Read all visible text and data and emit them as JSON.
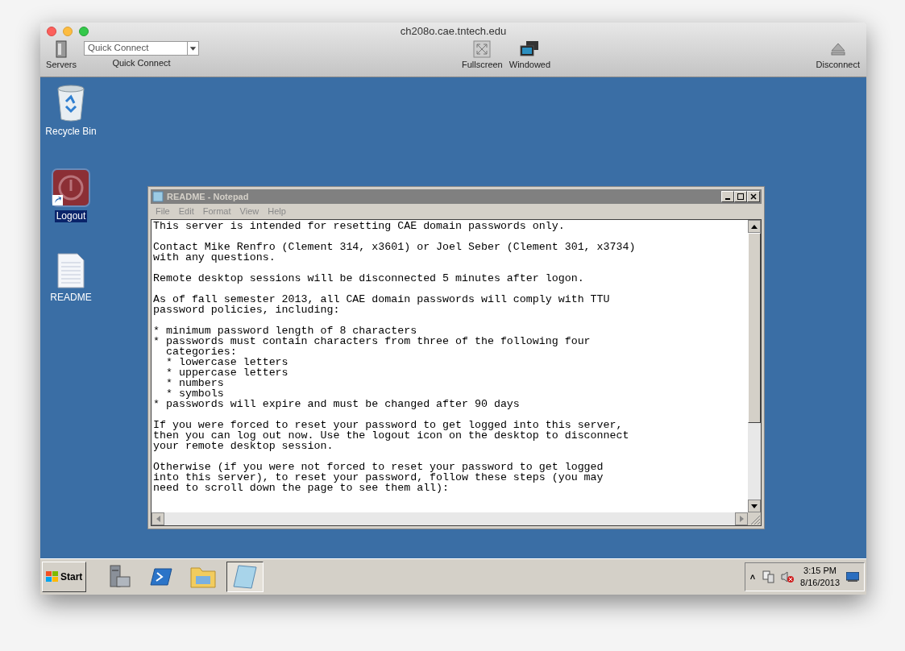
{
  "window": {
    "title": "ch208o.cae.tntech.edu"
  },
  "toolbar": {
    "servers": "Servers",
    "quick_connect": {
      "value": "Quick Connect",
      "label": "Quick Connect"
    },
    "fullscreen": "Fullscreen",
    "windowed": "Windowed",
    "disconnect": "Disconnect"
  },
  "desktop_icons": [
    {
      "kind": "recycle",
      "label": "Recycle Bin",
      "selected": false
    },
    {
      "kind": "logout",
      "label": "Logout",
      "selected": true
    },
    {
      "kind": "document",
      "label": "README",
      "selected": false
    }
  ],
  "notepad": {
    "title": "README - Notepad",
    "menu": [
      "File",
      "Edit",
      "Format",
      "View",
      "Help"
    ],
    "paragraphs": [
      [
        "This server is intended for resetting CAE domain passwords only."
      ],
      [
        "Contact Mike Renfro (Clement 314, x3601) or Joel Seber (Clement 301, x3734)",
        "with any questions."
      ],
      [
        "Remote desktop sessions will be disconnected 5 minutes after logon."
      ],
      [
        "As of fall semester 2013, all CAE domain passwords will comply with TTU",
        "password policies, including:"
      ],
      [
        "* minimum password length of 8 characters",
        "* passwords must contain characters from three of the following four",
        "  categories:",
        "  * lowercase letters",
        "  * uppercase letters",
        "  * numbers",
        "  * symbols",
        "* passwords will expire and must be changed after 90 days"
      ],
      [
        "If you were forced to reset your password to get logged into this server,",
        "then you can log out now. Use the logout icon on the desktop to disconnect",
        "your remote desktop session."
      ],
      [
        "Otherwise (if you were not forced to reset your password to get logged",
        "into this server), to reset your password, follow these steps (you may",
        "need to scroll down the page to see them all):"
      ]
    ]
  },
  "taskbar": {
    "start": "Start",
    "apps": [
      {
        "kind": "server",
        "selected": false
      },
      {
        "kind": "powershell",
        "selected": false
      },
      {
        "kind": "explorer",
        "selected": false
      },
      {
        "kind": "notepad",
        "selected": true
      }
    ],
    "tray": {
      "expander": "˄",
      "time": "3:15 PM",
      "date": "8/16/2013"
    }
  }
}
